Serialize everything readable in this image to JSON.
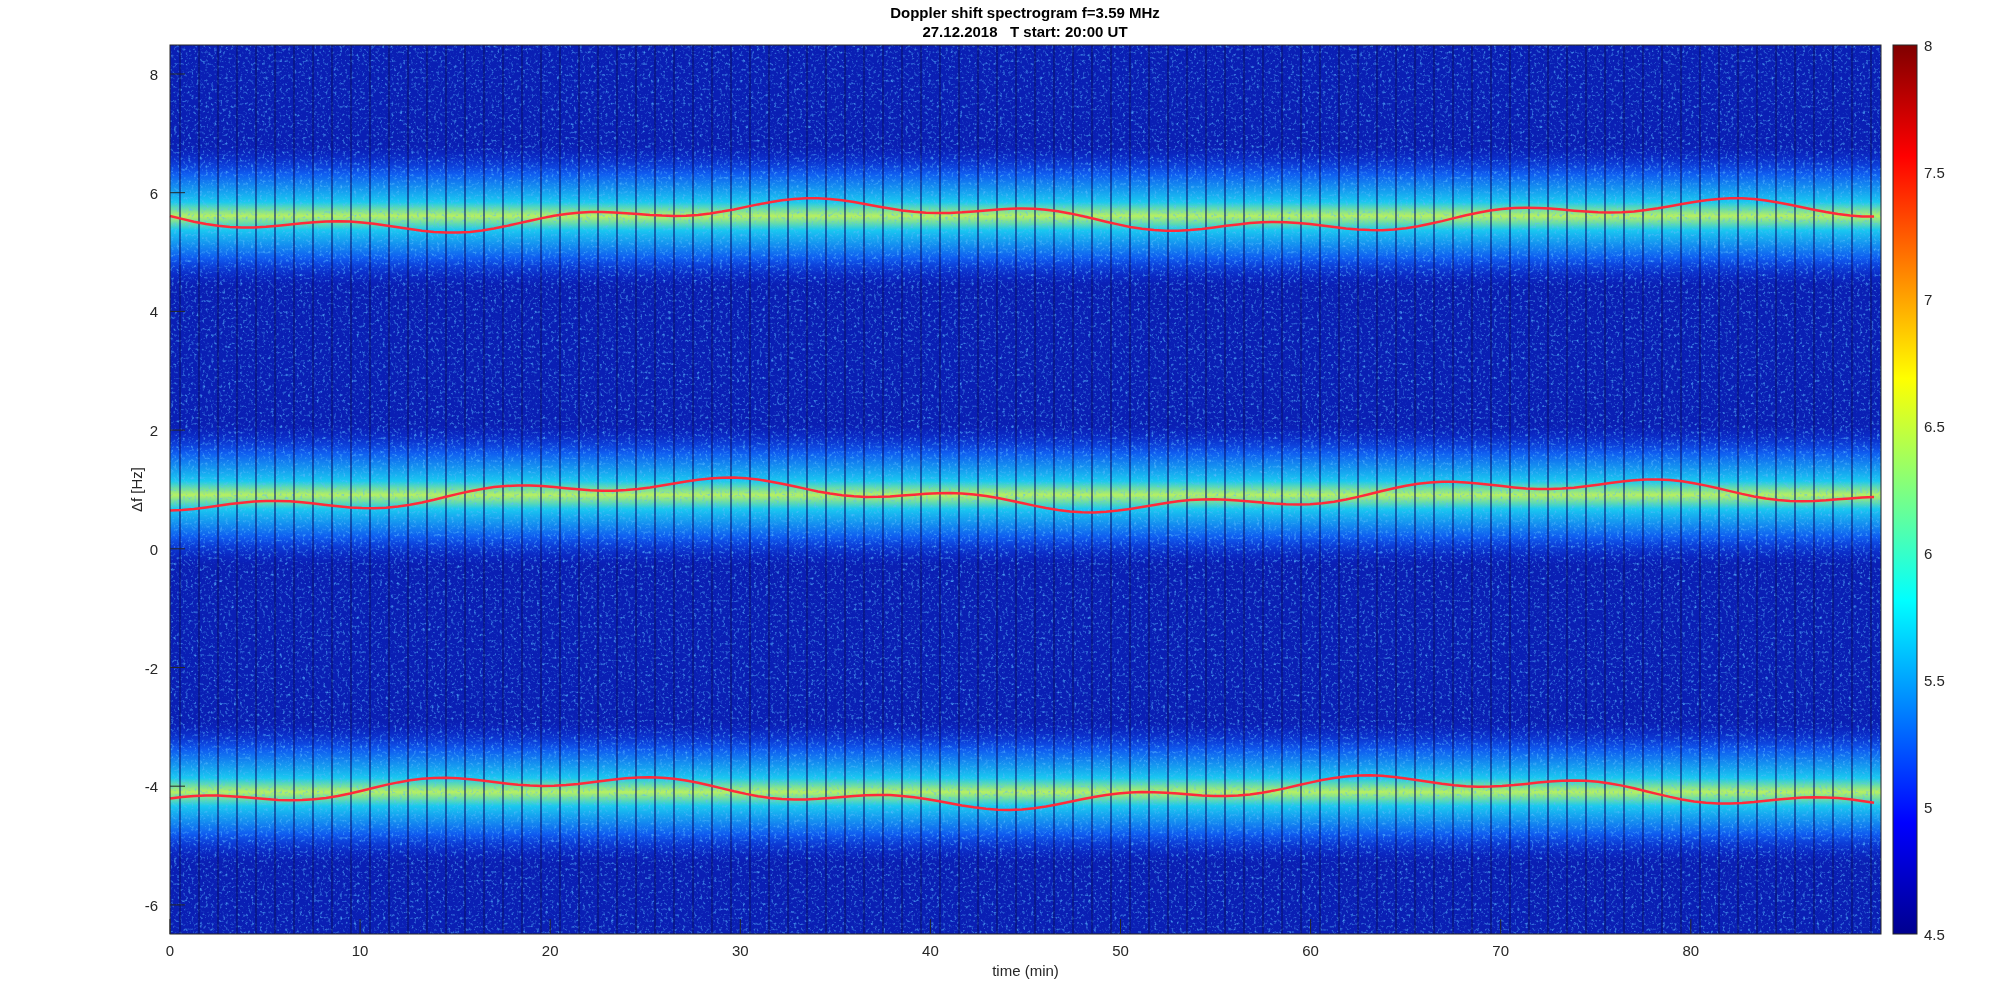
{
  "figure": {
    "title": "Doppler shift spectrogram f=3.59 MHz",
    "subtitle": "27.12.2018   T start: 20:00 UT",
    "xlabel": "time (min)",
    "ylabel": "Δf [Hz]",
    "x_tick_labels": [
      "0",
      "10",
      "20",
      "30",
      "40",
      "50",
      "60",
      "70",
      "80"
    ],
    "y_tick_labels": [
      "8",
      "6",
      "4",
      "2",
      "0",
      "-2",
      "-4",
      "-6"
    ],
    "colorbar_tick_labels": [
      "8",
      "7.5",
      "7",
      "6.5",
      "6",
      "5.5",
      "5",
      "4.5"
    ]
  }
}
